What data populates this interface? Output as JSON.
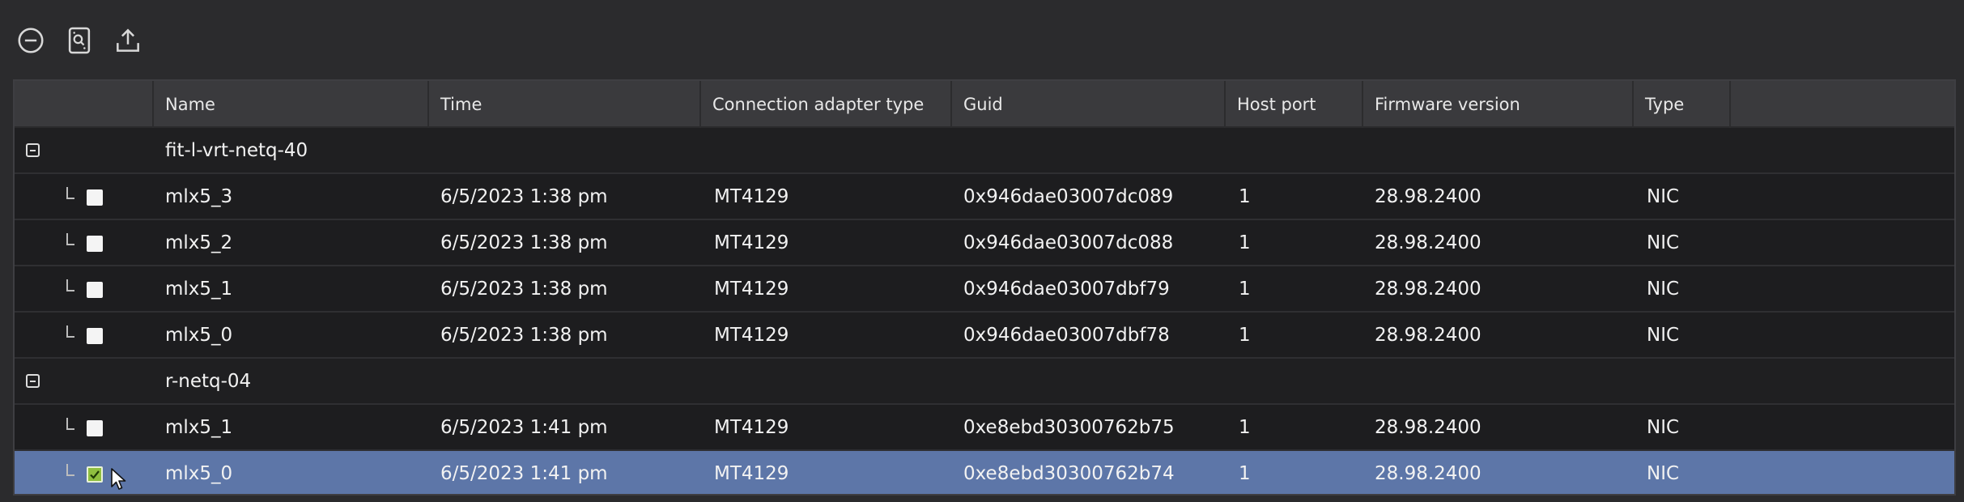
{
  "toolbar": {
    "icons": [
      "collapse-all-icon",
      "device-scan-icon",
      "export-icon"
    ]
  },
  "columns": [
    "Name",
    "Time",
    "Connection adapter type",
    "Guid",
    "Host port",
    "Firmware version",
    "Type"
  ],
  "groups": [
    {
      "host": "fit-l-vrt-netq-40",
      "rows": [
        {
          "name": "mlx5_3",
          "time": "6/5/2023 1:38 pm",
          "adapter": "MT4129",
          "guid": "0x946dae03007dc089",
          "port": "1",
          "firmware": "28.98.2400",
          "type": "NIC",
          "checked": false
        },
        {
          "name": "mlx5_2",
          "time": "6/5/2023 1:38 pm",
          "adapter": "MT4129",
          "guid": "0x946dae03007dc088",
          "port": "1",
          "firmware": "28.98.2400",
          "type": "NIC",
          "checked": false
        },
        {
          "name": "mlx5_1",
          "time": "6/5/2023 1:38 pm",
          "adapter": "MT4129",
          "guid": "0x946dae03007dbf79",
          "port": "1",
          "firmware": "28.98.2400",
          "type": "NIC",
          "checked": false
        },
        {
          "name": "mlx5_0",
          "time": "6/5/2023 1:38 pm",
          "adapter": "MT4129",
          "guid": "0x946dae03007dbf78",
          "port": "1",
          "firmware": "28.98.2400",
          "type": "NIC",
          "checked": false
        }
      ]
    },
    {
      "host": "r-netq-04",
      "rows": [
        {
          "name": "mlx5_1",
          "time": "6/5/2023 1:41 pm",
          "adapter": "MT4129",
          "guid": "0xe8ebd30300762b75",
          "port": "1",
          "firmware": "28.98.2400",
          "type": "NIC",
          "checked": false
        },
        {
          "name": "mlx5_0",
          "time": "6/5/2023 1:41 pm",
          "adapter": "MT4129",
          "guid": "0xe8ebd30300762b74",
          "port": "1",
          "firmware": "28.98.2400",
          "type": "NIC",
          "checked": true,
          "selected": true
        }
      ]
    }
  ],
  "colors": {
    "selected_row": "#5d76a8",
    "checkbox_checked": "#8fbf3f"
  }
}
